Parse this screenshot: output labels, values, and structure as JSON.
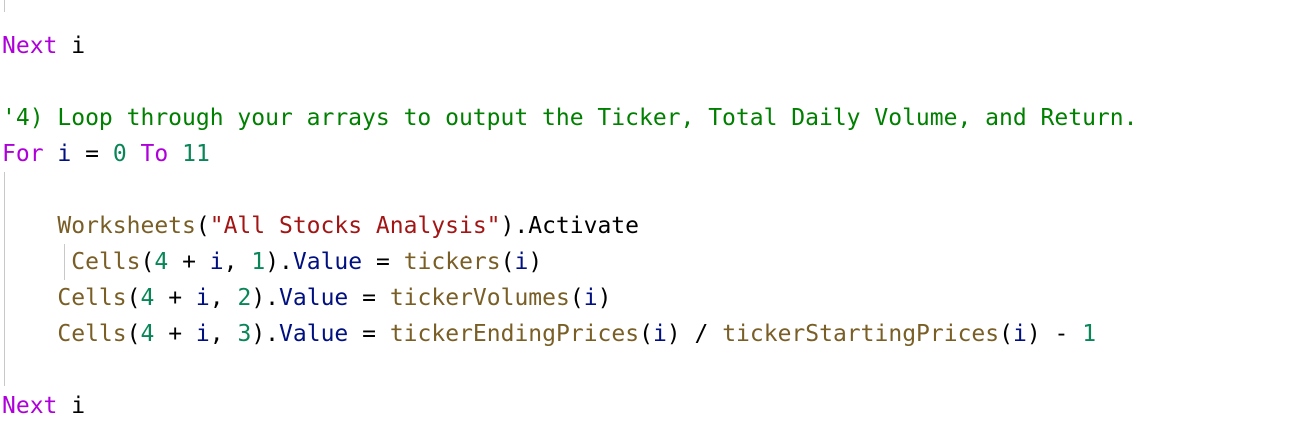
{
  "code_lines": [
    {
      "key": "line1",
      "tokens": [
        {
          "t": "Next",
          "c": "kw"
        },
        {
          "t": " ",
          "c": "op"
        },
        {
          "t": "i",
          "c": "op"
        }
      ]
    },
    {
      "key": "line3",
      "tokens": [
        {
          "t": "'4) Loop through your arrays to output the Ticker, Total Daily Volume, and Return.",
          "c": "cm"
        }
      ]
    },
    {
      "key": "line4",
      "tokens": [
        {
          "t": "For",
          "c": "kw"
        },
        {
          "t": " ",
          "c": "op"
        },
        {
          "t": "i",
          "c": "var"
        },
        {
          "t": " = ",
          "c": "op"
        },
        {
          "t": "0",
          "c": "num"
        },
        {
          "t": " ",
          "c": "op"
        },
        {
          "t": "To",
          "c": "kw"
        },
        {
          "t": " ",
          "c": "op"
        },
        {
          "t": "11",
          "c": "num"
        }
      ]
    },
    {
      "key": "line6",
      "tokens": [
        {
          "t": "    ",
          "c": "op"
        },
        {
          "t": "Worksheets",
          "c": "fn"
        },
        {
          "t": "(",
          "c": "op"
        },
        {
          "t": "\"All Stocks Analysis\"",
          "c": "str"
        },
        {
          "t": ").Activate",
          "c": "op"
        }
      ]
    },
    {
      "key": "line7",
      "tokens": [
        {
          "t": "     ",
          "c": "op"
        },
        {
          "t": "Cells",
          "c": "fn"
        },
        {
          "t": "(",
          "c": "op"
        },
        {
          "t": "4",
          "c": "num"
        },
        {
          "t": " + ",
          "c": "op"
        },
        {
          "t": "i",
          "c": "var"
        },
        {
          "t": ", ",
          "c": "op"
        },
        {
          "t": "1",
          "c": "num"
        },
        {
          "t": ").",
          "c": "op"
        },
        {
          "t": "Value",
          "c": "var"
        },
        {
          "t": " = ",
          "c": "op"
        },
        {
          "t": "tickers",
          "c": "fn"
        },
        {
          "t": "(",
          "c": "op"
        },
        {
          "t": "i",
          "c": "var"
        },
        {
          "t": ")",
          "c": "op"
        }
      ]
    },
    {
      "key": "line8",
      "tokens": [
        {
          "t": "    ",
          "c": "op"
        },
        {
          "t": "Cells",
          "c": "fn"
        },
        {
          "t": "(",
          "c": "op"
        },
        {
          "t": "4",
          "c": "num"
        },
        {
          "t": " + ",
          "c": "op"
        },
        {
          "t": "i",
          "c": "var"
        },
        {
          "t": ", ",
          "c": "op"
        },
        {
          "t": "2",
          "c": "num"
        },
        {
          "t": ").",
          "c": "op"
        },
        {
          "t": "Value",
          "c": "var"
        },
        {
          "t": " = ",
          "c": "op"
        },
        {
          "t": "tickerVolumes",
          "c": "fn"
        },
        {
          "t": "(",
          "c": "op"
        },
        {
          "t": "i",
          "c": "var"
        },
        {
          "t": ")",
          "c": "op"
        }
      ]
    },
    {
      "key": "line9",
      "tokens": [
        {
          "t": "    ",
          "c": "op"
        },
        {
          "t": "Cells",
          "c": "fn"
        },
        {
          "t": "(",
          "c": "op"
        },
        {
          "t": "4",
          "c": "num"
        },
        {
          "t": " + ",
          "c": "op"
        },
        {
          "t": "i",
          "c": "var"
        },
        {
          "t": ", ",
          "c": "op"
        },
        {
          "t": "3",
          "c": "num"
        },
        {
          "t": ").",
          "c": "op"
        },
        {
          "t": "Value",
          "c": "var"
        },
        {
          "t": " = ",
          "c": "op"
        },
        {
          "t": "tickerEndingPrices",
          "c": "fn"
        },
        {
          "t": "(",
          "c": "op"
        },
        {
          "t": "i",
          "c": "var"
        },
        {
          "t": ") / ",
          "c": "op"
        },
        {
          "t": "tickerStartingPrices",
          "c": "fn"
        },
        {
          "t": "(",
          "c": "op"
        },
        {
          "t": "i",
          "c": "var"
        },
        {
          "t": ") - ",
          "c": "op"
        },
        {
          "t": "1",
          "c": "num"
        }
      ]
    },
    {
      "key": "line11",
      "tokens": [
        {
          "t": "Next",
          "c": "kw"
        },
        {
          "t": " ",
          "c": "op"
        },
        {
          "t": "i",
          "c": "op"
        }
      ]
    }
  ],
  "colors": {
    "keyword": "#af00db",
    "comment": "#008000",
    "function": "#795e26",
    "string": "#a31515",
    "number": "#098658",
    "variable": "#001080",
    "indent_guide": "#c8c8c8"
  }
}
